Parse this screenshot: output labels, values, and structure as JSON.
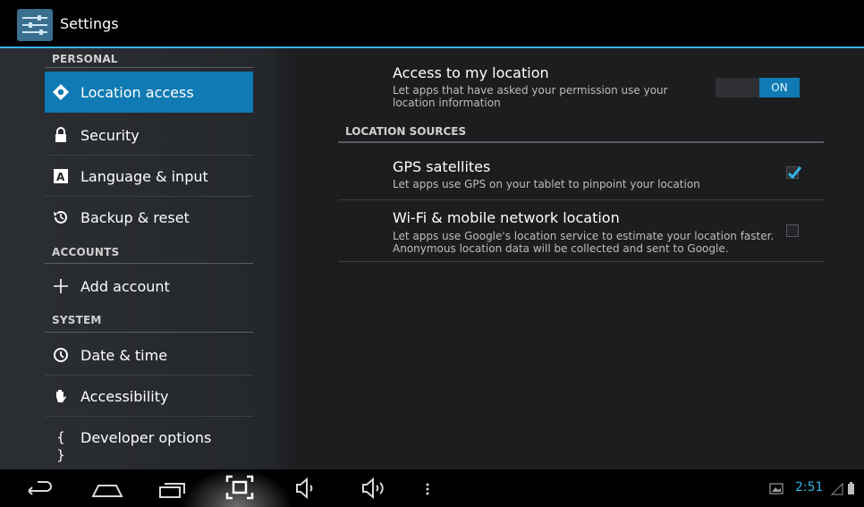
{
  "app": {
    "title": "Settings",
    "icon": "settings-sliders-icon"
  },
  "sidebar": {
    "sections": {
      "personal": "PERSONAL",
      "accounts": "ACCOUNTS",
      "system": "SYSTEM"
    },
    "items": [
      {
        "label": "Location access",
        "icon": "location-icon",
        "selected": true
      },
      {
        "label": "Security",
        "icon": "lock-icon"
      },
      {
        "label": "Language & input",
        "icon": "keyboard-icon"
      },
      {
        "label": "Backup & reset",
        "icon": "restore-icon"
      },
      {
        "label": "Add account",
        "icon": "plus-icon"
      },
      {
        "label": "Date & time",
        "icon": "clock-icon"
      },
      {
        "label": "Accessibility",
        "icon": "hand-icon"
      },
      {
        "label": "Developer options",
        "icon": "braces-icon"
      }
    ]
  },
  "main": {
    "access": {
      "title": "Access to my location",
      "summary_line1": "Let apps that have asked your permission use your",
      "summary_line2": "location information",
      "toggle_label": "ON",
      "toggle_state": true
    },
    "location_sources_header": "LOCATION SOURCES",
    "gps": {
      "title": "GPS satellites",
      "summary": "Let apps use GPS on your tablet to pinpoint your location",
      "checked": true
    },
    "wifi": {
      "title": "Wi-Fi & mobile network location",
      "summary_line1": "Let apps use Google's location service to estimate your location faster.",
      "summary_line2": "Anonymous location data will be collected and sent to Google.",
      "checked": false
    }
  },
  "navbar": {
    "buttons": [
      "back-icon",
      "home-icon",
      "recent-apps-icon",
      "screenshot-icon",
      "volume-down-icon",
      "volume-up-icon",
      "menu-icon"
    ],
    "status": {
      "time": "2:51",
      "icons": [
        "gallery-notification-icon",
        "signal-icon",
        "battery-icon"
      ]
    }
  },
  "colors": {
    "accent": "#33b5e5",
    "selected": "#0f7ab4"
  }
}
